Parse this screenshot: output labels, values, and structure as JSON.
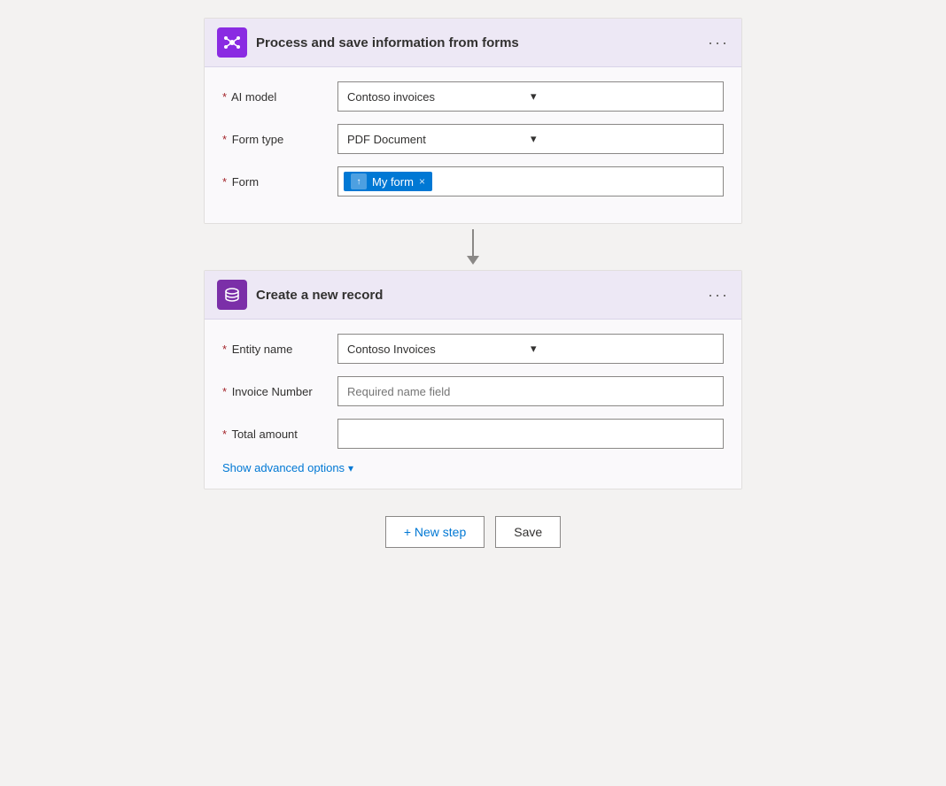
{
  "card1": {
    "title": "Process and save information from forms",
    "icon_type": "ai",
    "fields": {
      "ai_model": {
        "label": "AI model",
        "value": "Contoso invoices",
        "required": true
      },
      "form_type": {
        "label": "Form type",
        "value": "PDF Document",
        "required": true
      },
      "form": {
        "label": "Form",
        "required": true,
        "tag_text": "My form",
        "tag_icon": "↑"
      }
    },
    "dots_label": "···"
  },
  "card2": {
    "title": "Create a new record",
    "icon_type": "db",
    "fields": {
      "entity_name": {
        "label": "Entity name",
        "value": "Contoso Invoices",
        "required": true
      },
      "invoice_number": {
        "label": "Invoice Number",
        "placeholder": "Required name field",
        "required": true
      },
      "total_amount": {
        "label": "Total amount",
        "placeholder": "",
        "required": true
      }
    },
    "advanced_options_label": "Show advanced options",
    "dots_label": "···"
  },
  "actions": {
    "new_step_label": "+ New step",
    "save_label": "Save"
  }
}
